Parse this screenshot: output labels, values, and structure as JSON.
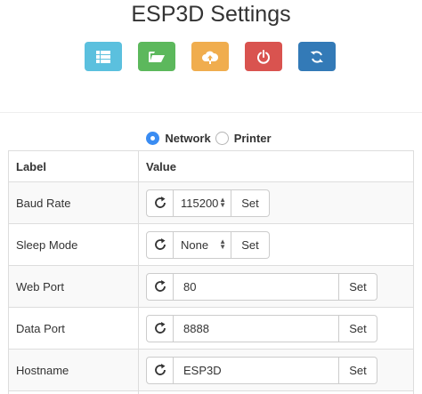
{
  "page": {
    "title": "ESP3D Settings"
  },
  "toolbar": {
    "buttons": [
      {
        "name": "list-button",
        "icon": "list-icon",
        "color": "#5bc0de"
      },
      {
        "name": "files-button",
        "icon": "folder-open-icon",
        "color": "#5cb85c"
      },
      {
        "name": "upload-button",
        "icon": "cloud-upload-icon",
        "color": "#f0ad4e"
      },
      {
        "name": "power-button",
        "icon": "power-icon",
        "color": "#d9534f"
      },
      {
        "name": "refresh-button",
        "icon": "refresh-icon",
        "color": "#337ab7"
      }
    ]
  },
  "tabs": {
    "network_label": "Network",
    "printer_label": "Printer",
    "selected": "Network",
    "accent": "#3a8cf2"
  },
  "table": {
    "col_label": "Label",
    "col_value": "Value",
    "rows": [
      {
        "label": "Baud Rate",
        "type": "select",
        "value": "115200",
        "button": "Set"
      },
      {
        "label": "Sleep Mode",
        "type": "select",
        "value": "None",
        "button": "Set"
      },
      {
        "label": "Web Port",
        "type": "input",
        "value": "80",
        "button": "Set"
      },
      {
        "label": "Data Port",
        "type": "input",
        "value": "8888",
        "button": "Set"
      },
      {
        "label": "Hostname",
        "type": "input",
        "value": "ESP3D",
        "button": "Set"
      }
    ]
  }
}
